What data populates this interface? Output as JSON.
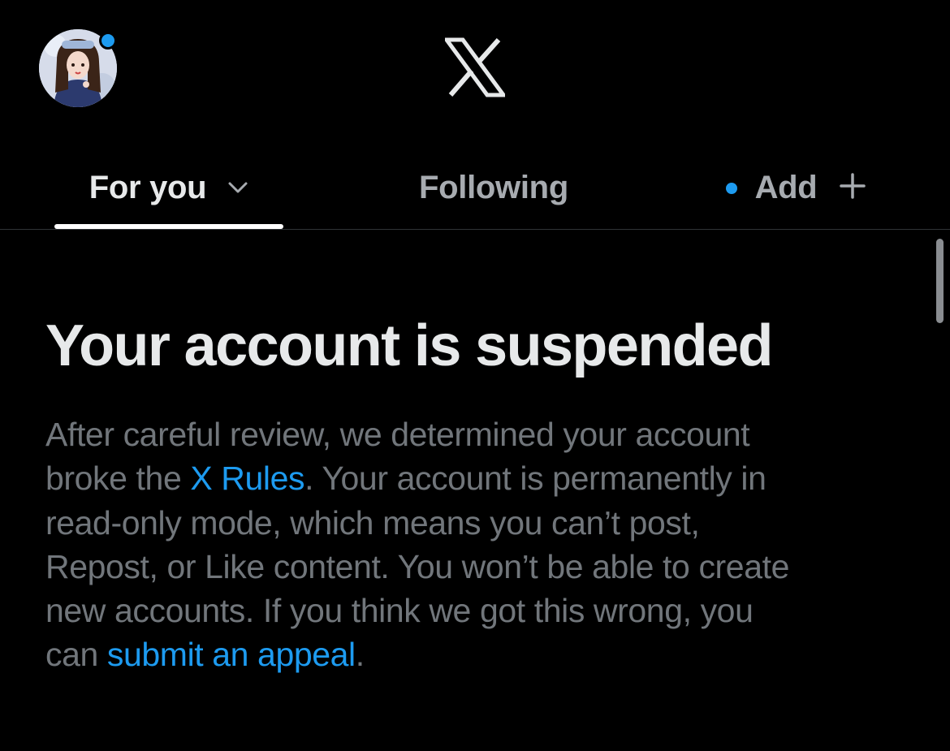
{
  "header": {
    "logo_icon": "x-logo-icon",
    "avatar_icon": "profile-avatar",
    "notification_dot_color": "#1d9bf0"
  },
  "tabs": [
    {
      "label": "For you",
      "active": true,
      "icon": "chevron-down-icon"
    },
    {
      "label": "Following",
      "active": false
    },
    {
      "label": "Add",
      "active": false,
      "icon": "plus-icon",
      "dot": true
    }
  ],
  "notice": {
    "title": "Your account is suspended",
    "line1": "After careful review, we determined your account",
    "line2_pre": "broke the ",
    "rules_link": "X Rules",
    "line2_post": ". Your account is permanently in",
    "line3": "read-only mode, which means you can’t post,",
    "line4": "Repost, or Like content. You won’t be able to create",
    "line5": "new accounts. If you think we got this wrong, you",
    "line6_pre": "can ",
    "appeal_link": "submit an appeal",
    "line6_post": "."
  },
  "colors": {
    "background": "#000000",
    "accent": "#1d9bf0",
    "primary_text": "#e7e9ea",
    "secondary_text": "#71767b"
  }
}
